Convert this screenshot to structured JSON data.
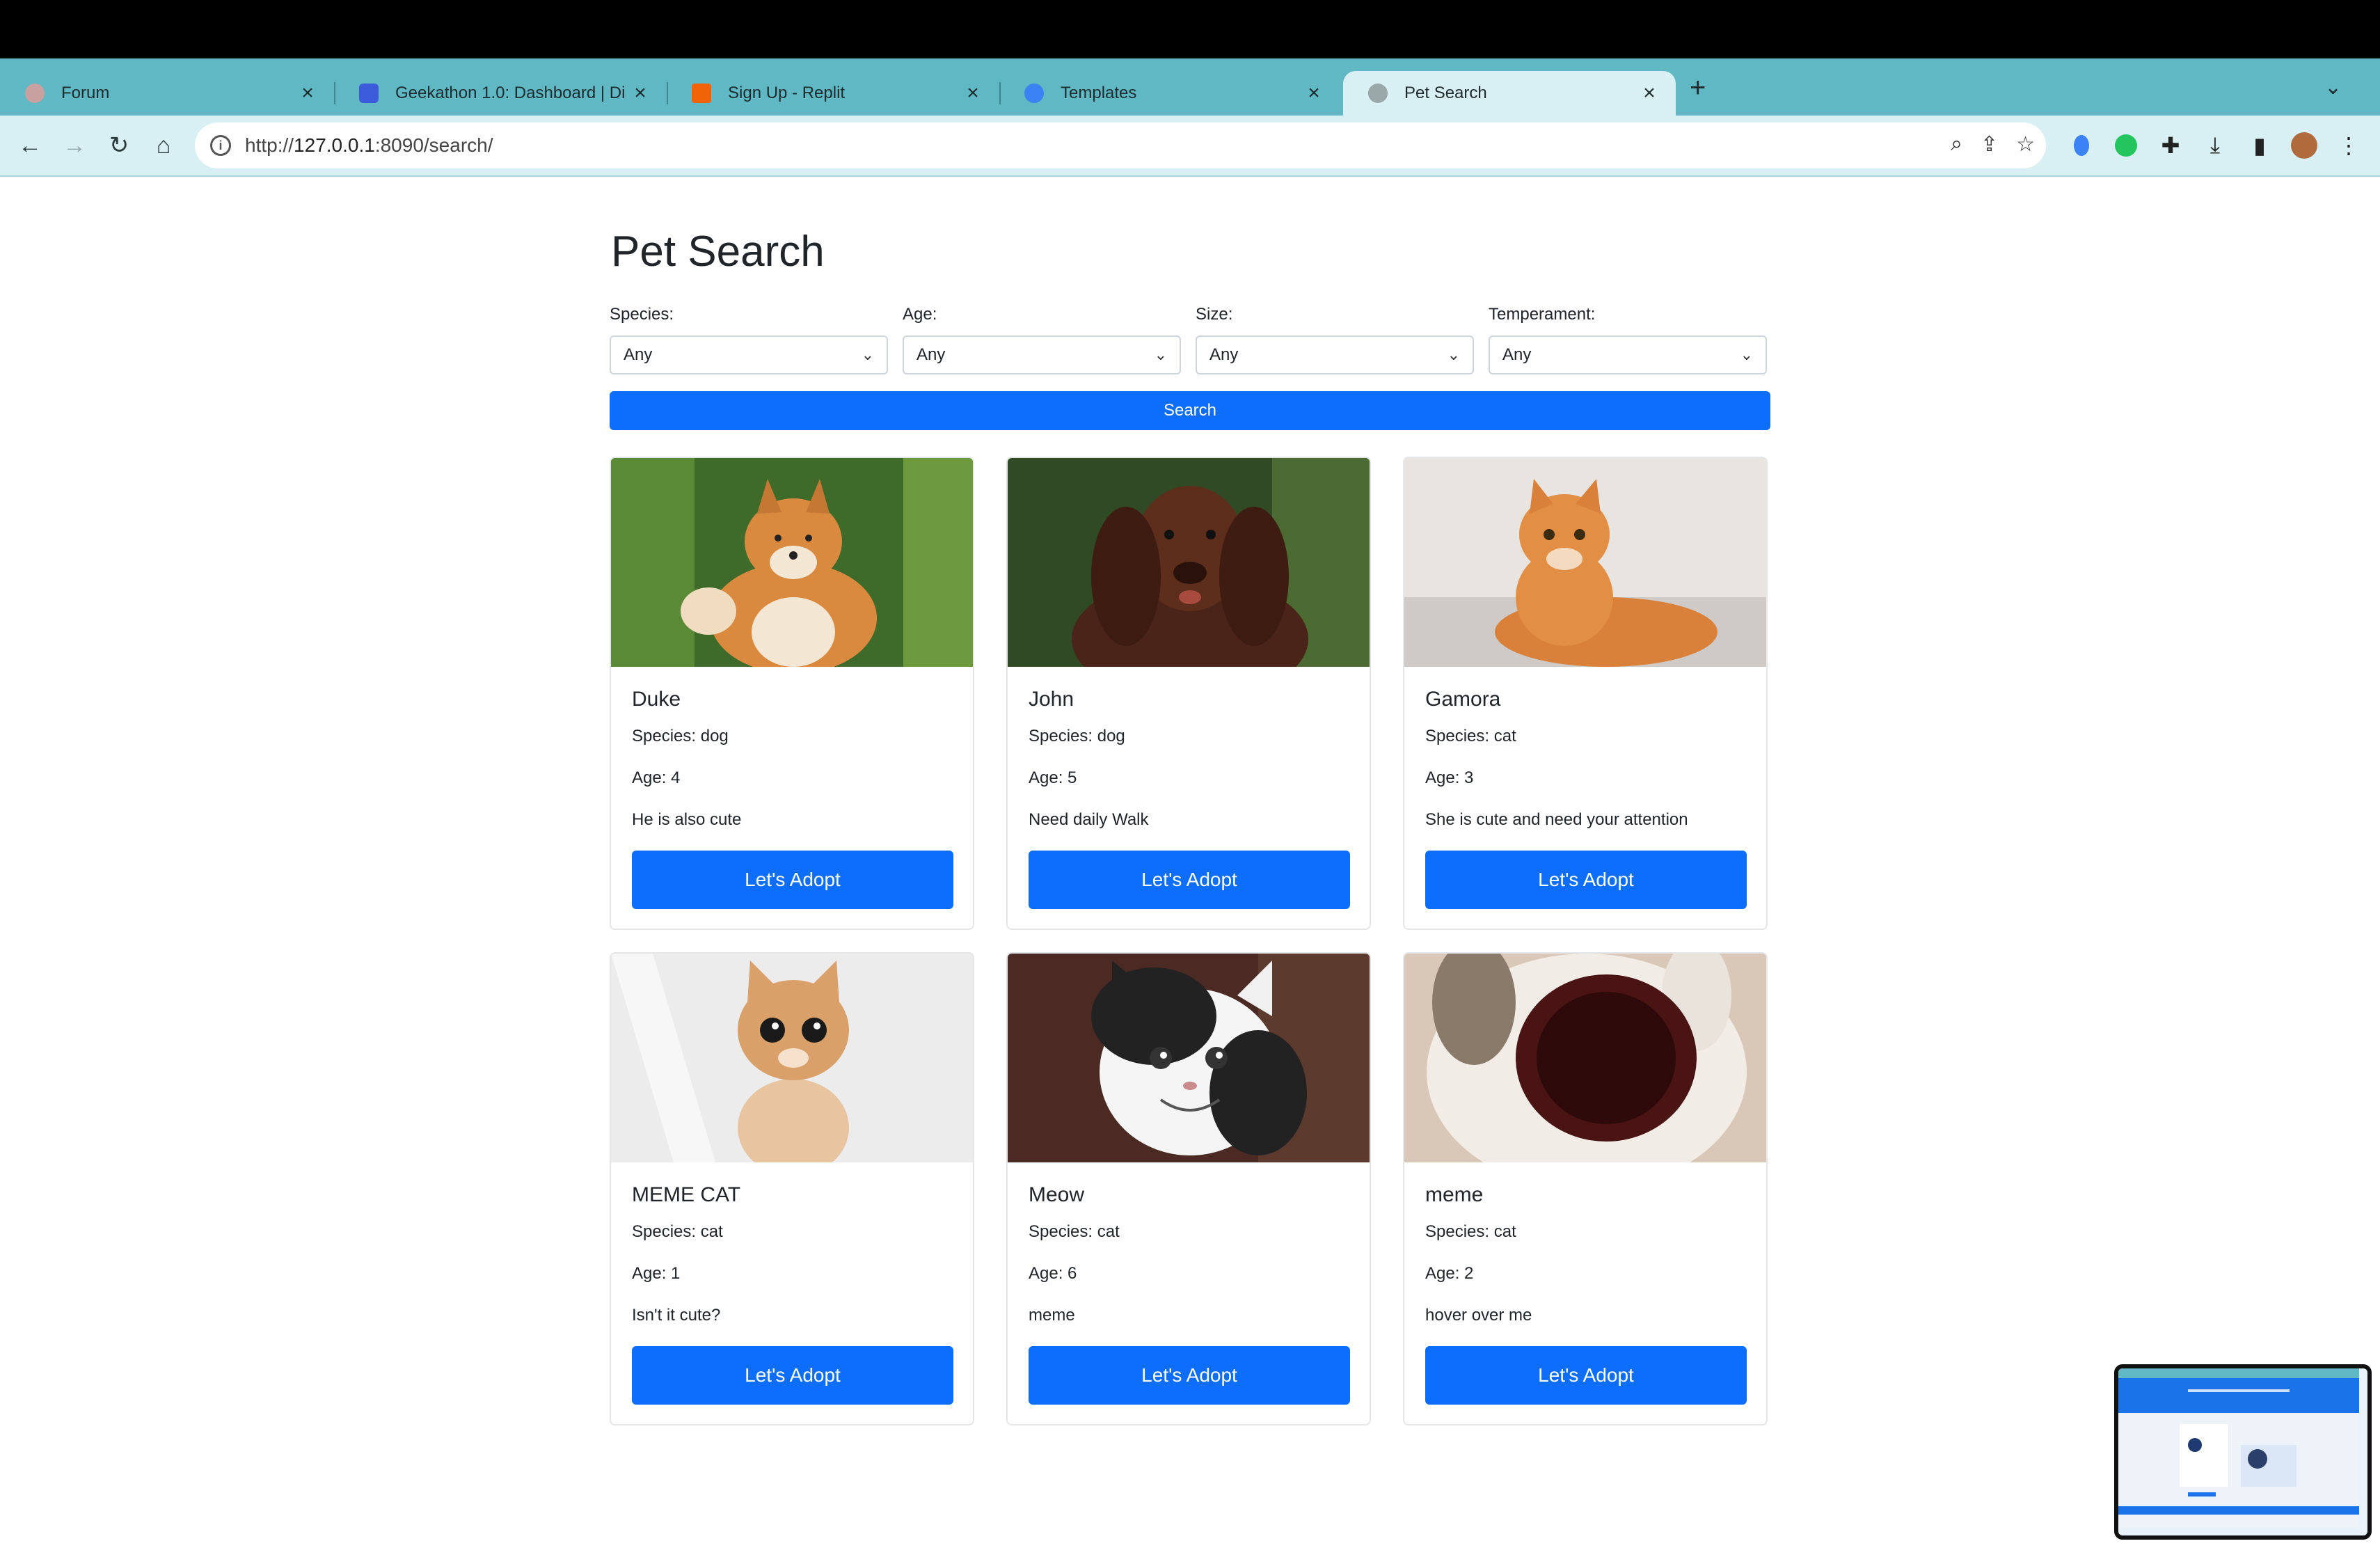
{
  "browser": {
    "tabs": [
      {
        "label": "Forum",
        "favicon_color": "#c9a0a0"
      },
      {
        "label": "Geekathon 1.0: Dashboard | Di",
        "favicon_color": "#3b5bdb"
      },
      {
        "label": "Sign Up - Replit",
        "favicon_color": "#f26207"
      },
      {
        "label": "Templates",
        "favicon_color": "#3b82f6"
      },
      {
        "label": "Pet Search",
        "favicon_color": "#9aa8aa"
      }
    ],
    "active_tab": 4,
    "url_prefix": "http://",
    "url_host": "127.0.0.1",
    "url_rest": ":8090/search/"
  },
  "page": {
    "title": "Pet Search",
    "filters": [
      {
        "label": "Species:",
        "value": "Any"
      },
      {
        "label": "Age:",
        "value": "Any"
      },
      {
        "label": "Size:",
        "value": "Any"
      },
      {
        "label": "Temperament:",
        "value": "Any"
      }
    ],
    "search_label": "Search",
    "adopt_label": "Let's Adopt"
  },
  "pets": [
    {
      "name": "Duke",
      "species": "Species: dog",
      "age": "Age: 4",
      "description": "He is also cute"
    },
    {
      "name": "John",
      "species": "Species: dog",
      "age": "Age: 5",
      "description": "Need daily Walk"
    },
    {
      "name": "Gamora",
      "species": "Species: cat",
      "age": "Age: 3",
      "description": "She is cute and need your attention"
    },
    {
      "name": "MEME CAT",
      "species": "Species: cat",
      "age": "Age: 1",
      "description": "Isn't it cute?"
    },
    {
      "name": "Meow",
      "species": "Species: cat",
      "age": "Age: 6",
      "description": "meme"
    },
    {
      "name": "meme",
      "species": "Species: cat",
      "age": "Age: 2",
      "description": "hover over me"
    }
  ],
  "colors": {
    "primary": "#0d6efd",
    "tabbar": "#5fb8c3",
    "toolbar": "#d8f0f3"
  }
}
